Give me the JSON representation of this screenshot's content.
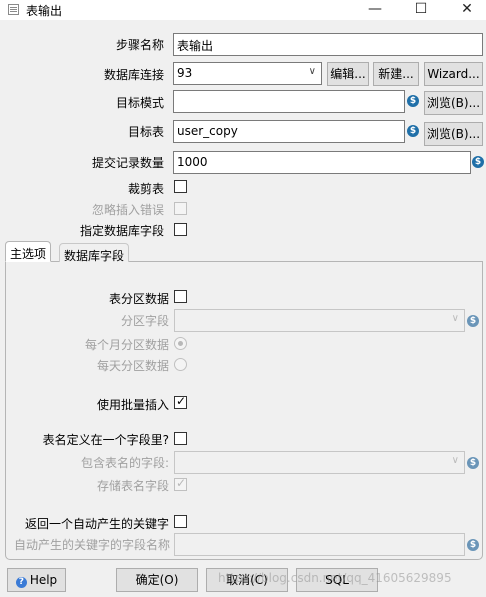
{
  "window": {
    "title": "表输出",
    "minimize_glyph": "—",
    "maximize_glyph": "☐",
    "close_glyph": "✕"
  },
  "form": {
    "step_name_label": "步骤名称",
    "step_name_value": "表输出",
    "connection_label": "数据库连接",
    "connection_value": "93",
    "edit_button": "编辑...",
    "new_button": "新建...",
    "wizard_button": "Wizard...",
    "target_schema_label": "目标模式",
    "target_schema_value": "",
    "browse_button": "浏览(B)...",
    "target_table_label": "目标表",
    "target_table_value": "user_copy",
    "commit_size_label": "提交记录数量",
    "commit_size_value": "1000",
    "truncate_label": "裁剪表",
    "ignore_errors_label": "忽略插入错误",
    "specify_fields_label": "指定数据库字段"
  },
  "tabs": {
    "main_options": "主选项",
    "database_fields": "数据库字段"
  },
  "main_tab": {
    "partition_label": "表分区数据",
    "partition_field_label": "分区字段",
    "partition_field_value": "",
    "monthly_label": "每个月分区数据",
    "daily_label": "每天分区数据",
    "batch_insert_label": "使用批量插入",
    "tablename_in_field_label": "表名定义在一个字段里?",
    "tablename_field_label": "包含表名的字段:",
    "tablename_field_value": "",
    "store_tablename_label": "存储表名字段",
    "return_key_label": "返回一个自动产生的关键字",
    "key_field_name_label": "自动产生的关键字的字段名称",
    "key_field_name_value": ""
  },
  "states": {
    "truncate_checked": false,
    "ignore_errors_checked": false,
    "specify_fields_checked": false,
    "partition_checked": false,
    "monthly_selected": true,
    "daily_selected": false,
    "batch_insert_checked": true,
    "tablename_in_field_checked": false,
    "store_tablename_checked": true,
    "return_key_checked": false
  },
  "footer": {
    "help_button": "Help",
    "ok_button": "确定(O)",
    "cancel_button": "取消(C)",
    "sql_button": "SQL",
    "watermark": "https://blog.csdn.net/qq_41605629895"
  },
  "glyphs": {
    "variable_icon": "$",
    "help_icon": "?",
    "dropdown_chevron": "∨",
    "check_mark": "✓"
  },
  "colors": {
    "variable_icon": "#1f6fa8",
    "help_icon": "#3b7bd6",
    "disabled_text": "#a0a0a0"
  }
}
